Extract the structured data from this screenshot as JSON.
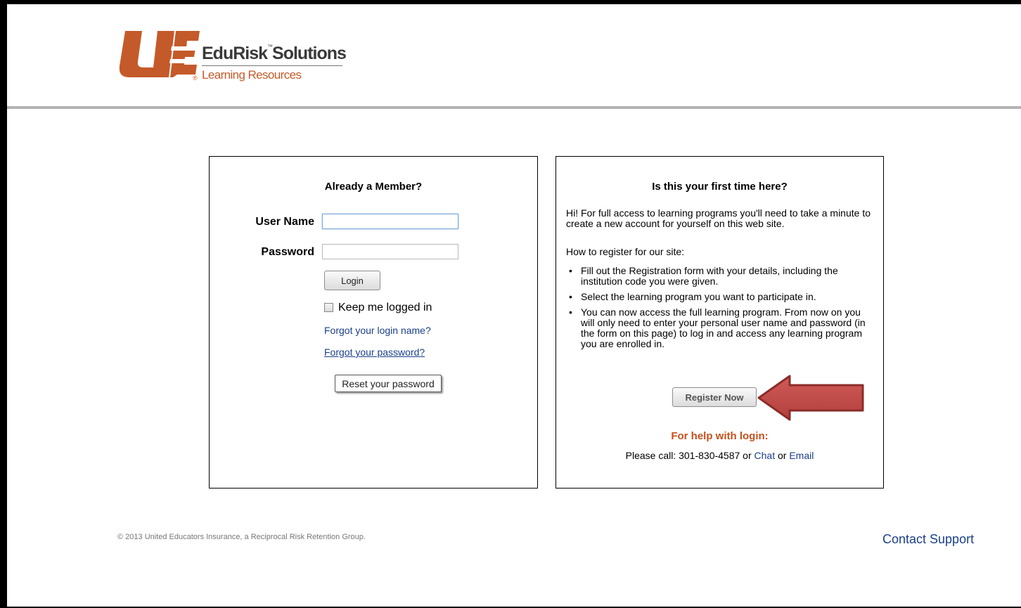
{
  "brand": {
    "name": "EduRisk Solutions",
    "name_main": "EduRisk",
    "trademark": "™",
    "name_tail": "Solutions",
    "subtitle": "Learning Resources",
    "registered": "®",
    "logo_icon": "ue-logo-icon",
    "accent_color": "#c45a2a"
  },
  "login_panel": {
    "title": "Already a Member?",
    "username_label": "User Name",
    "username_value": "",
    "password_label": "Password",
    "password_value": "",
    "login_button": "Login",
    "keep_logged_in_label": "Keep me logged in",
    "keep_logged_in_checked": false,
    "forgot_login_link": "Forgot your login name?",
    "forgot_password_link": "Forgot your password?",
    "reset_button": "Reset your password"
  },
  "register_panel": {
    "title": "Is this your first time here?",
    "intro": "Hi! For full access to learning programs you'll need to take a minute to create a new account for yourself on this web site.",
    "how_to": "How to register for our site:",
    "bullet_char": "•",
    "steps": [
      "Fill out the Registration form with your details, including the institution code you were given.",
      "Select the learning program you want to participate in.",
      "You can now access the full learning program. From now on you will only need to enter your personal user name and password (in the form on this page) to log in and access any learning program you are enrolled in."
    ],
    "register_button": "Register Now",
    "help_title": "For help with login:",
    "help_prefix": "Please call: 301-830-4587 or ",
    "chat_link": "Chat",
    "help_or": " or ",
    "email_link": "Email",
    "help_color": "#c5501e",
    "arrow_icon": "red-arrow-left-icon",
    "arrow_color": "#c0504d"
  },
  "footer": {
    "copyright": "© 2013 United Educators Insurance, a Reciprocal Risk Retention Group.",
    "contact_link": "Contact Support"
  }
}
